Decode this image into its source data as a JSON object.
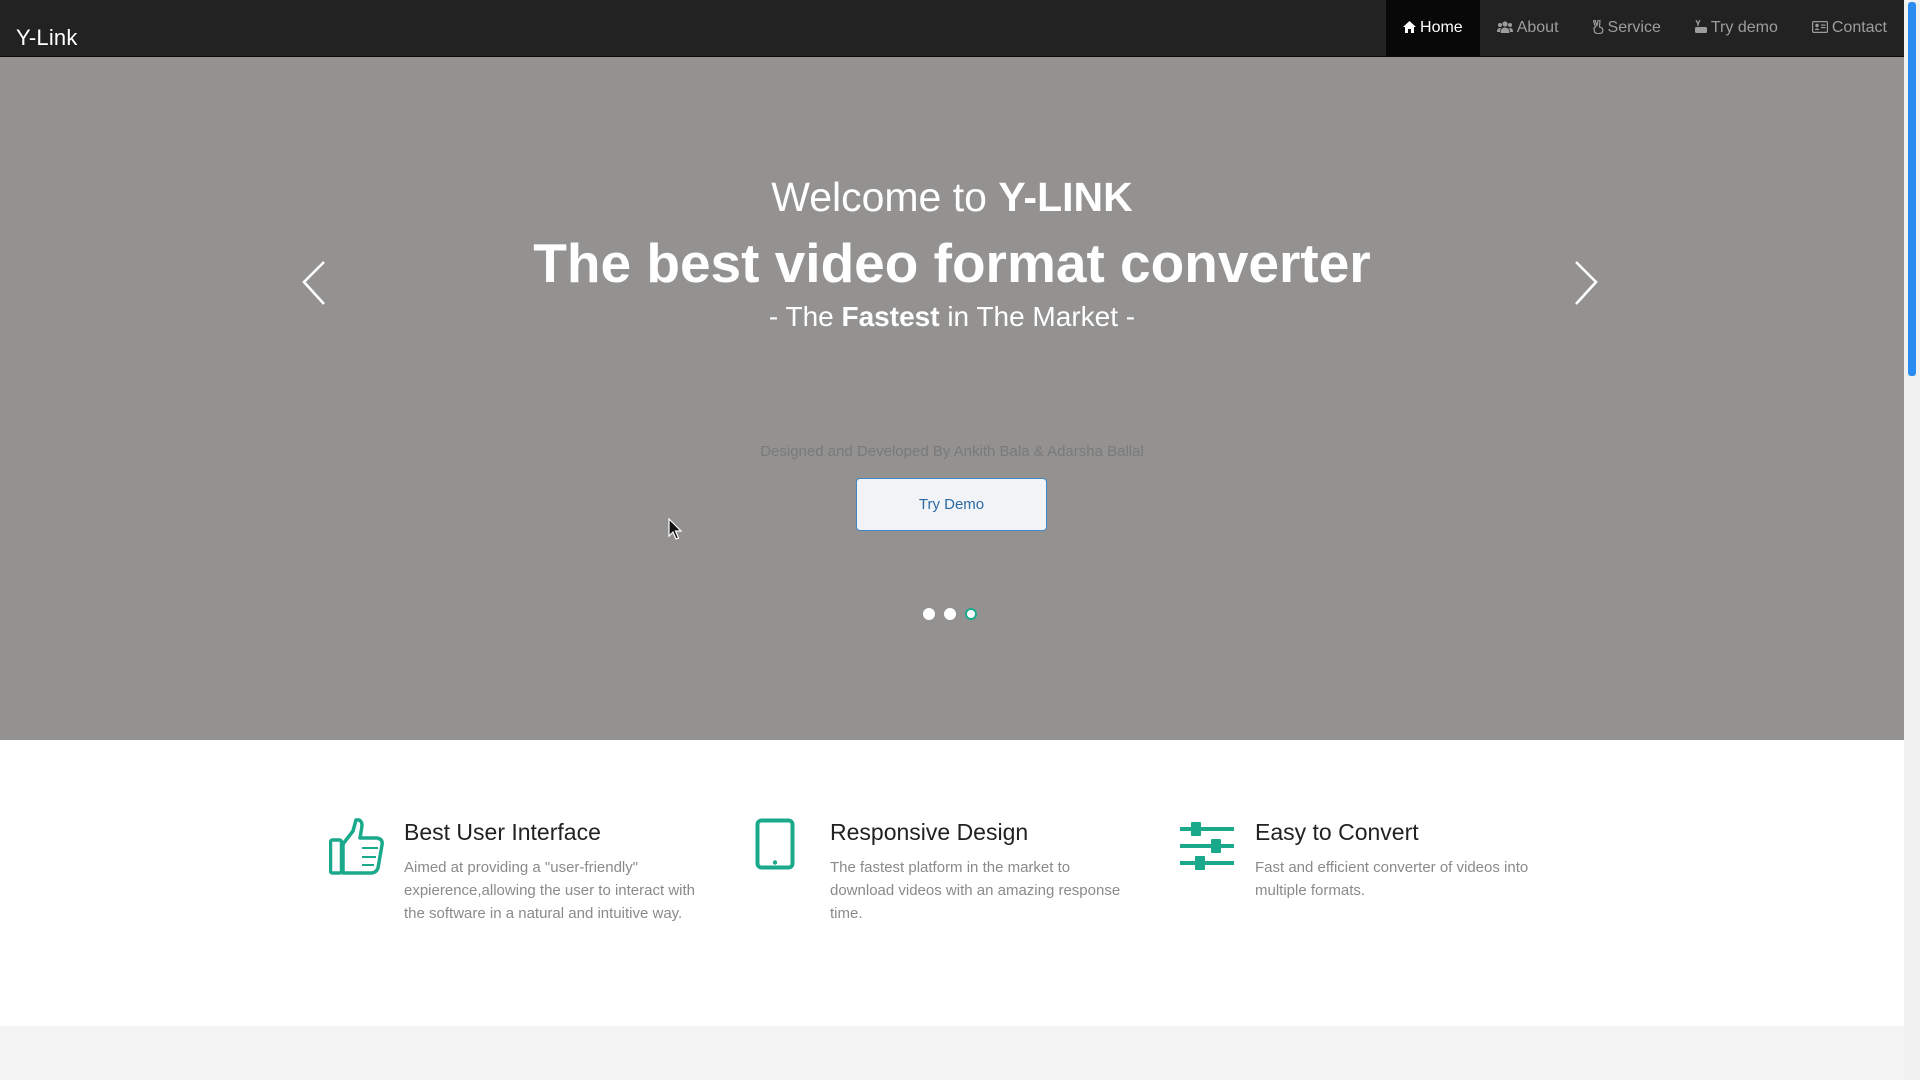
{
  "brand": "Y-Link",
  "nav": [
    {
      "label": "Home",
      "icon": "home-icon",
      "active": true
    },
    {
      "label": "About",
      "icon": "users-icon",
      "active": false
    },
    {
      "label": "Service",
      "icon": "hand-peace-icon",
      "active": false
    },
    {
      "label": "Try demo",
      "icon": "youtube-icon",
      "active": false
    },
    {
      "label": "Contact",
      "icon": "address-card-icon",
      "active": false
    }
  ],
  "hero": {
    "welcome_prefix": "Welcome to ",
    "welcome_brand": "Y-LINK",
    "headline": "The best video format converter",
    "tagline_prefix": "- The ",
    "tagline_bold": "Fastest",
    "tagline_suffix": " in The Market -",
    "credit": "Designed and Developed By Ankith Bala & Adarsha Ballal",
    "button": "Try Demo",
    "slides_total": 3,
    "active_slide": 3
  },
  "features": [
    {
      "icon": "thumbs-up-icon",
      "title": "Best User Interface",
      "text": "Aimed at providing a \"user-friendly\" expierence,allowing the user to interact with the software in a natural and intuitive way."
    },
    {
      "icon": "tablet-icon",
      "title": "Responsive Design",
      "text": "The fastest platform in the market to download videos with an amazing response time."
    },
    {
      "icon": "sliders-icon",
      "title": "Easy to Convert",
      "text": "Fast and efficient converter of videos into multiple formats."
    }
  ],
  "colors": {
    "navbar": "#222222",
    "hero_bg": "#939291",
    "accent": "#1aa98a",
    "button_text": "#2b6aa3"
  }
}
